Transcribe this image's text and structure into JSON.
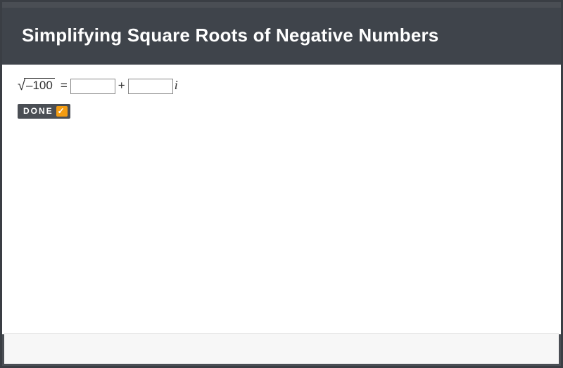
{
  "header": {
    "title": "Simplifying Square Roots of Negative Numbers"
  },
  "equation": {
    "surd": "√",
    "radicand": "–100",
    "equals": "=",
    "input1": "",
    "plus": "+",
    "input2": "",
    "imag": "i"
  },
  "buttons": {
    "done_label": "DONE",
    "done_check": "✓"
  }
}
